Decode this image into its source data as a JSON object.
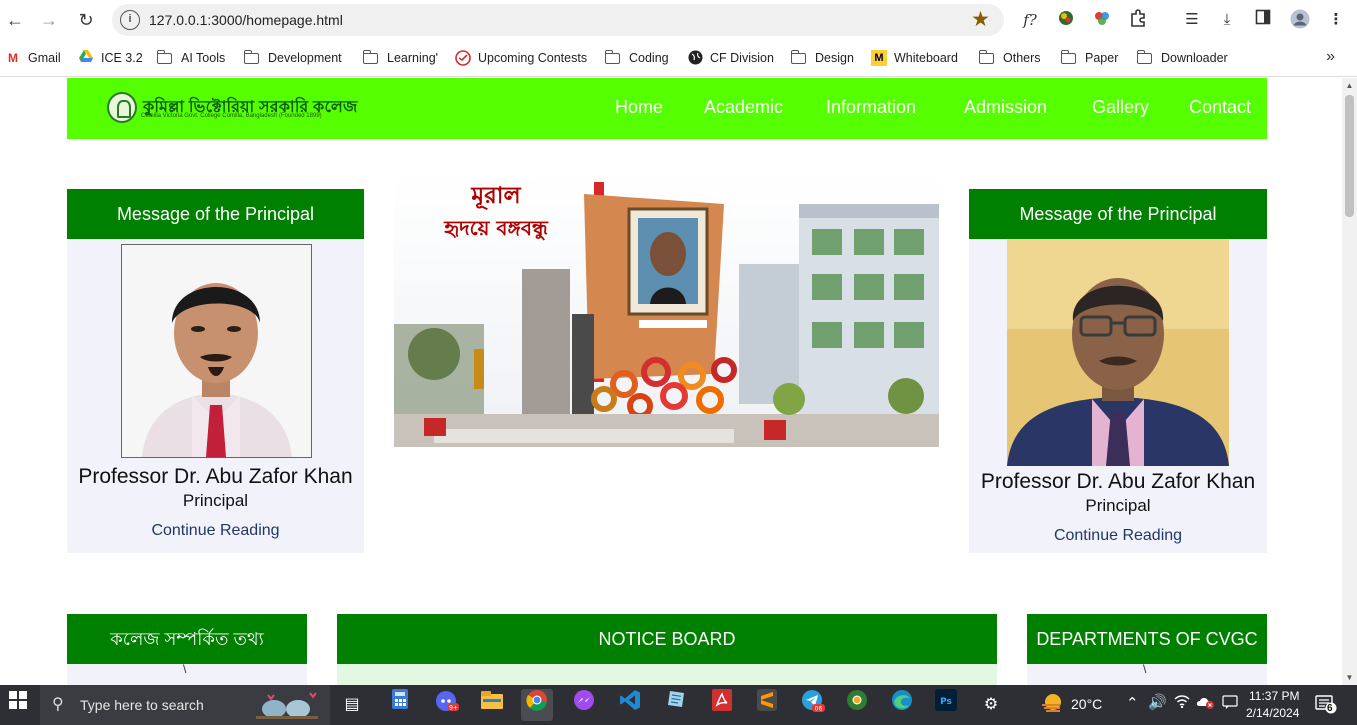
{
  "browser": {
    "url": "127.0.0.1:3000/homepage.html",
    "bookmarks": [
      {
        "label": "Gmail",
        "icon": "gmail-icon"
      },
      {
        "label": "ICE 3.2",
        "icon": "drive-icon"
      },
      {
        "label": "AI Tools",
        "icon": "folder-icon"
      },
      {
        "label": "Development",
        "icon": "folder-icon"
      },
      {
        "label": "Learning'",
        "icon": "folder-icon"
      },
      {
        "label": "Upcoming Contests",
        "icon": "contest-icon"
      },
      {
        "label": "Coding",
        "icon": "folder-icon"
      },
      {
        "label": "CF Division",
        "icon": "globe-icon"
      },
      {
        "label": "Design",
        "icon": "folder-icon"
      },
      {
        "label": "Whiteboard",
        "icon": "miro-icon"
      },
      {
        "label": "Others",
        "icon": "folder-icon"
      },
      {
        "label": "Paper",
        "icon": "folder-icon"
      },
      {
        "label": "Downloader",
        "icon": "folder-icon"
      }
    ]
  },
  "site": {
    "logo_title": "কুমিল্লা ভিক্টোরিয়া সরকারি কলেজ",
    "logo_subtitle": "Comilla Victoria Govt. College Comilla, Bangladesh (Founded 1899)",
    "menu": [
      "Home",
      "Academic",
      "Information",
      "Admission",
      "Gallery",
      "Contact"
    ],
    "principal_left": {
      "heading": "Message of the Principal",
      "name": "Professor Dr. Abu Zafor Khan",
      "role": "Principal",
      "link": "Continue Reading"
    },
    "principal_right": {
      "heading": "Message of the Principal",
      "name": "Professor Dr. Abu Zafor Khan",
      "role": "Principal",
      "link": "Continue Reading"
    },
    "banner": {
      "caption_line1": "মূরাল",
      "caption_line2": "হৃদয়ে বঙ্গবন্ধু"
    },
    "sections": {
      "college_info": "কলেজ সম্পর্কিত তথ্য",
      "notice_board": "NOTICE BOARD",
      "departments": "DEPARTMENTS OF CVGC"
    }
  },
  "taskbar": {
    "search_placeholder": "Type here to search",
    "weather": "20°C",
    "time": "11:37 PM",
    "date": "2/14/2024",
    "notifications": "6"
  },
  "colors": {
    "nav_bg": "#55ff00",
    "header_green": "#008000",
    "card_bg": "#f2f2fb"
  }
}
